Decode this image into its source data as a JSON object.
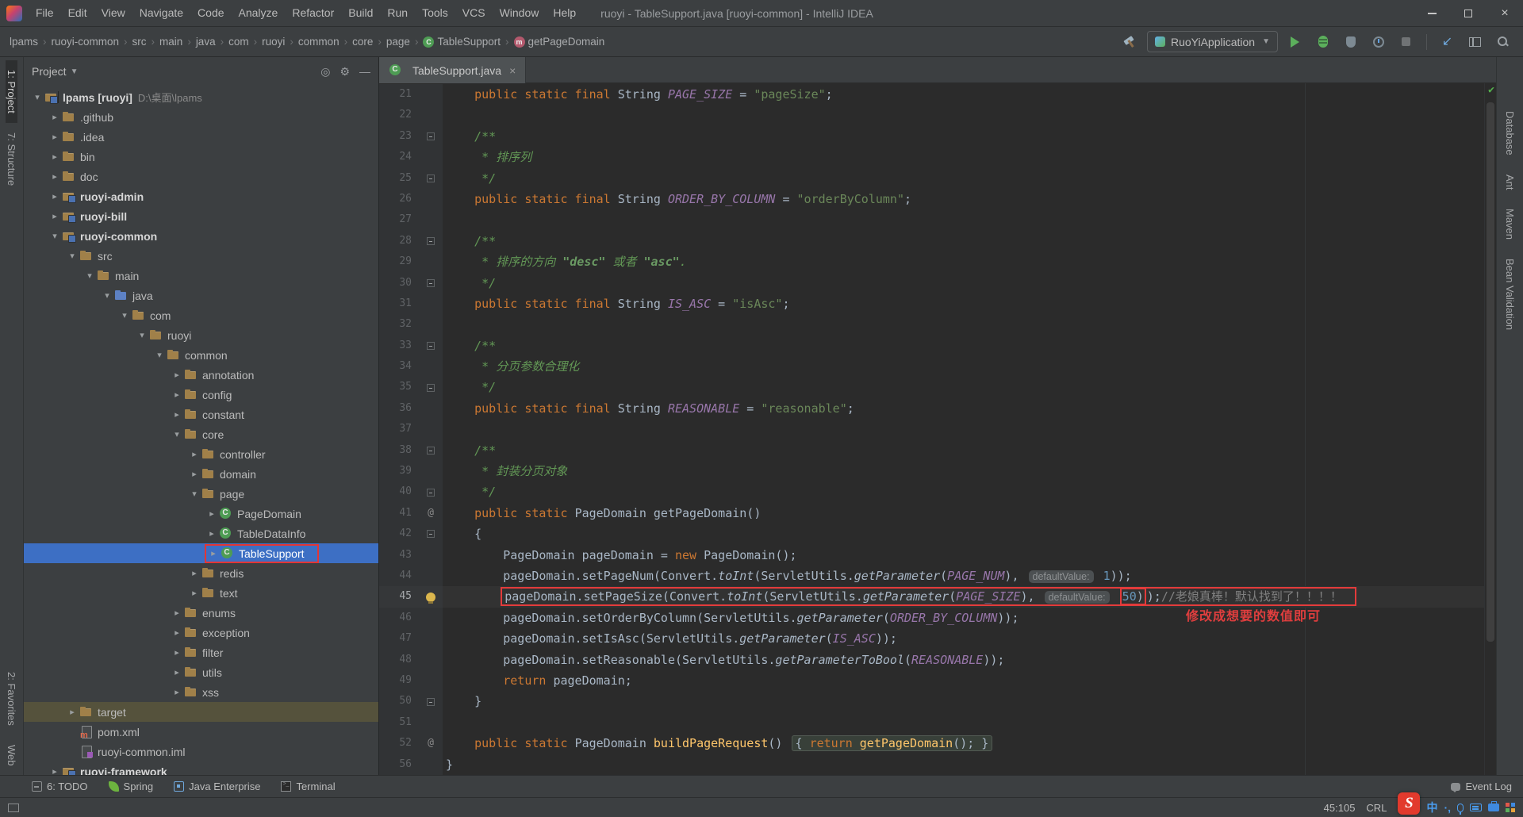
{
  "window": {
    "title": "ruoyi - TableSupport.java [ruoyi-common] - IntelliJ IDEA"
  },
  "menu": {
    "items": [
      "File",
      "Edit",
      "View",
      "Navigate",
      "Code",
      "Analyze",
      "Refactor",
      "Build",
      "Run",
      "Tools",
      "VCS",
      "Window",
      "Help"
    ]
  },
  "breadcrumbs": {
    "items": [
      {
        "label": "lpams"
      },
      {
        "label": "ruoyi-common"
      },
      {
        "label": "src"
      },
      {
        "label": "main"
      },
      {
        "label": "java"
      },
      {
        "label": "com"
      },
      {
        "label": "ruoyi"
      },
      {
        "label": "common"
      },
      {
        "label": "core"
      },
      {
        "label": "page"
      },
      {
        "label": "TableSupport",
        "icon": "class"
      },
      {
        "label": "getPageDomain",
        "icon": "method"
      }
    ]
  },
  "toolbar": {
    "run_config": "RuoYiApplication",
    "icons": [
      "build-hammer-icon",
      "run-icon",
      "debug-icon",
      "coverage-icon",
      "profiler-icon",
      "stop-icon",
      "update-project-icon",
      "layout-icon",
      "search-everywhere-icon"
    ]
  },
  "left_strip": {
    "top": [
      {
        "label": "1: Project",
        "active": true
      },
      {
        "label": "7: Structure"
      }
    ],
    "bottom": [
      {
        "label": "2: Favorites"
      },
      {
        "label": "Web"
      }
    ]
  },
  "right_strip": {
    "top": [
      {
        "label": "Database"
      },
      {
        "label": "Ant"
      },
      {
        "label": "Maven"
      },
      {
        "label": "Bean Validation"
      }
    ]
  },
  "project": {
    "header": "Project",
    "tree": [
      {
        "label": "lpams [ruoyi]",
        "path": "D:\\桌面\\lpams",
        "level": 0,
        "chev": "open",
        "icon": "project",
        "bold": true
      },
      {
        "label": ".github",
        "level": 1,
        "chev": "closed",
        "icon": "folder"
      },
      {
        "label": ".idea",
        "level": 1,
        "chev": "closed",
        "icon": "folder"
      },
      {
        "label": "bin",
        "level": 1,
        "chev": "closed",
        "icon": "folder"
      },
      {
        "label": "doc",
        "level": 1,
        "chev": "closed",
        "icon": "folder"
      },
      {
        "label": "ruoyi-admin",
        "level": 1,
        "chev": "closed",
        "icon": "module",
        "bold": true
      },
      {
        "label": "ruoyi-bill",
        "level": 1,
        "chev": "closed",
        "icon": "module",
        "bold": true
      },
      {
        "label": "ruoyi-common",
        "level": 1,
        "chev": "open",
        "icon": "module",
        "bold": true
      },
      {
        "label": "src",
        "level": 2,
        "chev": "open",
        "icon": "folder"
      },
      {
        "label": "main",
        "level": 3,
        "chev": "open",
        "icon": "folder"
      },
      {
        "label": "java",
        "level": 4,
        "chev": "open",
        "icon": "srcroot"
      },
      {
        "label": "com",
        "level": 5,
        "chev": "open",
        "icon": "package"
      },
      {
        "label": "ruoyi",
        "level": 6,
        "chev": "open",
        "icon": "package"
      },
      {
        "label": "common",
        "level": 7,
        "chev": "open",
        "icon": "package"
      },
      {
        "label": "annotation",
        "level": 8,
        "chev": "closed",
        "icon": "package"
      },
      {
        "label": "config",
        "level": 8,
        "chev": "closed",
        "icon": "package"
      },
      {
        "label": "constant",
        "level": 8,
        "chev": "closed",
        "icon": "package"
      },
      {
        "label": "core",
        "level": 8,
        "chev": "open",
        "icon": "package"
      },
      {
        "label": "controller",
        "level": 9,
        "chev": "closed",
        "icon": "package"
      },
      {
        "label": "domain",
        "level": 9,
        "chev": "closed",
        "icon": "package"
      },
      {
        "label": "page",
        "level": 9,
        "chev": "open",
        "icon": "package"
      },
      {
        "label": "PageDomain",
        "level": 10,
        "chev": "closed",
        "icon": "class"
      },
      {
        "label": "TableDataInfo",
        "level": 10,
        "chev": "closed",
        "icon": "class"
      },
      {
        "label": "TableSupport",
        "level": 10,
        "chev": "closed",
        "icon": "class",
        "selected": true,
        "redbox": true
      },
      {
        "label": "redis",
        "level": 9,
        "chev": "closed",
        "icon": "package"
      },
      {
        "label": "text",
        "level": 9,
        "chev": "closed",
        "icon": "package"
      },
      {
        "label": "enums",
        "level": 8,
        "chev": "closed",
        "icon": "package"
      },
      {
        "label": "exception",
        "level": 8,
        "chev": "closed",
        "icon": "package"
      },
      {
        "label": "filter",
        "level": 8,
        "chev": "closed",
        "icon": "package"
      },
      {
        "label": "utils",
        "level": 8,
        "chev": "closed",
        "icon": "package"
      },
      {
        "label": "xss",
        "level": 8,
        "chev": "closed",
        "icon": "package"
      },
      {
        "label": "target",
        "level": 2,
        "chev": "closed",
        "icon": "folder",
        "hl": true
      },
      {
        "label": "pom.xml",
        "level": 2,
        "chev": "none",
        "icon": "maven"
      },
      {
        "label": "ruoyi-common.iml",
        "level": 2,
        "chev": "none",
        "icon": "iml"
      },
      {
        "label": "ruoyi-framework",
        "level": 1,
        "chev": "closed",
        "icon": "module",
        "bold": true
      }
    ]
  },
  "editor": {
    "tab": "TableSupport.java",
    "lines": [
      {
        "n": 21,
        "segs": [
          {
            "t": "    ",
            "c": "p"
          },
          {
            "t": "public static final ",
            "c": "k"
          },
          {
            "t": "String ",
            "c": "p"
          },
          {
            "t": "PAGE_SIZE",
            "c": "f"
          },
          {
            "t": " = ",
            "c": "p"
          },
          {
            "t": "\"pageSize\"",
            "c": "s"
          },
          {
            "t": ";",
            "c": "p"
          }
        ]
      },
      {
        "n": 22,
        "segs": []
      },
      {
        "n": 23,
        "f": "s",
        "segs": [
          {
            "t": "    ",
            "c": "p"
          },
          {
            "t": "/**",
            "c": "d"
          }
        ]
      },
      {
        "n": 24,
        "segs": [
          {
            "t": "     * 排序列",
            "c": "d"
          }
        ]
      },
      {
        "n": 25,
        "f": "e",
        "segs": [
          {
            "t": "     */",
            "c": "d"
          }
        ]
      },
      {
        "n": 26,
        "segs": [
          {
            "t": "    ",
            "c": "p"
          },
          {
            "t": "public static final ",
            "c": "k"
          },
          {
            "t": "String ",
            "c": "p"
          },
          {
            "t": "ORDER_BY_COLUMN",
            "c": "f"
          },
          {
            "t": " = ",
            "c": "p"
          },
          {
            "t": "\"orderByColumn\"",
            "c": "s"
          },
          {
            "t": ";",
            "c": "p"
          }
        ]
      },
      {
        "n": 27,
        "segs": []
      },
      {
        "n": 28,
        "f": "s",
        "segs": [
          {
            "t": "    ",
            "c": "p"
          },
          {
            "t": "/**",
            "c": "d"
          }
        ]
      },
      {
        "n": 29,
        "segs": [
          {
            "t": "     * 排序的方向 ",
            "c": "d"
          },
          {
            "t": "\"desc\"",
            "c": "b"
          },
          {
            "t": " 或者 ",
            "c": "d"
          },
          {
            "t": "\"asc\"",
            "c": "b"
          },
          {
            "t": ".",
            "c": "d"
          }
        ]
      },
      {
        "n": 30,
        "f": "e",
        "segs": [
          {
            "t": "     */",
            "c": "d"
          }
        ]
      },
      {
        "n": 31,
        "segs": [
          {
            "t": "    ",
            "c": "p"
          },
          {
            "t": "public static final ",
            "c": "k"
          },
          {
            "t": "String ",
            "c": "p"
          },
          {
            "t": "IS_ASC",
            "c": "f"
          },
          {
            "t": " = ",
            "c": "p"
          },
          {
            "t": "\"isAsc\"",
            "c": "s"
          },
          {
            "t": ";",
            "c": "p"
          }
        ]
      },
      {
        "n": 32,
        "segs": []
      },
      {
        "n": 33,
        "f": "s",
        "segs": [
          {
            "t": "    ",
            "c": "p"
          },
          {
            "t": "/**",
            "c": "d"
          }
        ]
      },
      {
        "n": 34,
        "segs": [
          {
            "t": "     * 分页参数合理化",
            "c": "d"
          }
        ]
      },
      {
        "n": 35,
        "f": "e",
        "segs": [
          {
            "t": "     */",
            "c": "d"
          }
        ]
      },
      {
        "n": 36,
        "segs": [
          {
            "t": "    ",
            "c": "p"
          },
          {
            "t": "public static final ",
            "c": "k"
          },
          {
            "t": "String ",
            "c": "p"
          },
          {
            "t": "REASONABLE",
            "c": "f"
          },
          {
            "t": " = ",
            "c": "p"
          },
          {
            "t": "\"reasonable\"",
            "c": "s"
          },
          {
            "t": ";",
            "c": "p"
          }
        ]
      },
      {
        "n": 37,
        "segs": []
      },
      {
        "n": 38,
        "f": "s",
        "segs": [
          {
            "t": "    ",
            "c": "p"
          },
          {
            "t": "/**",
            "c": "d"
          }
        ]
      },
      {
        "n": 39,
        "segs": [
          {
            "t": "     * 封装分页对象",
            "c": "d"
          }
        ]
      },
      {
        "n": 40,
        "f": "e",
        "segs": [
          {
            "t": "     */",
            "c": "d"
          }
        ]
      },
      {
        "n": 41,
        "g": "@",
        "segs": [
          {
            "t": "    ",
            "c": "p"
          },
          {
            "t": "public static ",
            "c": "k"
          },
          {
            "t": "PageDomain getPageDomain()",
            "c": "p"
          }
        ]
      },
      {
        "n": 42,
        "f": "s",
        "segs": [
          {
            "t": "    {",
            "c": "p"
          }
        ]
      },
      {
        "n": 43,
        "segs": [
          {
            "t": "        PageDomain pageDomain = ",
            "c": "p"
          },
          {
            "t": "new",
            "c": "k"
          },
          {
            "t": " PageDomain();",
            "c": "p"
          }
        ]
      },
      {
        "n": 44,
        "segs": [
          {
            "t": "        pageDomain.setPageNum(Convert.",
            "c": "p"
          },
          {
            "t": "toInt",
            "c": "i"
          },
          {
            "t": "(ServletUtils.",
            "c": "p"
          },
          {
            "t": "getParameter",
            "c": "i"
          },
          {
            "t": "(",
            "c": "p"
          },
          {
            "t": "PAGE_NUM",
            "c": "f"
          },
          {
            "t": "), ",
            "c": "p"
          },
          {
            "t": "defaultValue:",
            "c": "h"
          },
          {
            "t": " ",
            "c": "p"
          },
          {
            "t": "1",
            "c": "n"
          },
          {
            "t": "));",
            "c": "p"
          }
        ]
      },
      {
        "n": 45,
        "cur": true,
        "bulb": true,
        "segs": [
          {
            "t": "        ",
            "c": "p"
          },
          {
            "outline": true,
            "parts": [
              {
                "t": "pageDomain.setPageSize(Convert.",
                "c": "p"
              },
              {
                "t": "toInt",
                "c": "i"
              },
              {
                "t": "(ServletUtils.",
                "c": "p"
              },
              {
                "t": "getParameter",
                "c": "i"
              },
              {
                "t": "(",
                "c": "p"
              },
              {
                "t": "PAGE_SIZE",
                "c": "f"
              },
              {
                "t": "), ",
                "c": "p"
              },
              {
                "t": "defaultValue:",
                "c": "h"
              },
              {
                "t": " ",
                "c": "p"
              },
              {
                "box": true,
                "parts": [
                  {
                    "t": "50",
                    "c": "n"
                  },
                  {
                    "t": ")",
                    "c": "p"
                  }
                ]
              },
              {
                "t": ");",
                "c": "p"
              },
              {
                "t": "//老娘真棒！默认找到了！！！！",
                "c": "c"
              }
            ]
          }
        ]
      },
      {
        "n": 46,
        "segs": [
          {
            "t": "        pageDomain.setOrderByColumn(ServletUtils.",
            "c": "p"
          },
          {
            "t": "getParameter",
            "c": "i"
          },
          {
            "t": "(",
            "c": "p"
          },
          {
            "t": "ORDER_BY_COLUMN",
            "c": "f"
          },
          {
            "t": "));",
            "c": "p"
          }
        ]
      },
      {
        "n": 47,
        "segs": [
          {
            "t": "        pageDomain.setIsAsc(ServletUtils.",
            "c": "p"
          },
          {
            "t": "getParameter",
            "c": "i"
          },
          {
            "t": "(",
            "c": "p"
          },
          {
            "t": "IS_ASC",
            "c": "f"
          },
          {
            "t": "));",
            "c": "p"
          }
        ]
      },
      {
        "n": 48,
        "segs": [
          {
            "t": "        pageDomain.setReasonable(ServletUtils.",
            "c": "p"
          },
          {
            "t": "getParameterToBool",
            "c": "i"
          },
          {
            "t": "(",
            "c": "p"
          },
          {
            "t": "REASONABLE",
            "c": "f"
          },
          {
            "t": "));",
            "c": "p"
          }
        ]
      },
      {
        "n": 49,
        "segs": [
          {
            "t": "        ",
            "c": "p"
          },
          {
            "t": "return",
            "c": "k"
          },
          {
            "t": " pageDomain;",
            "c": "p"
          }
        ]
      },
      {
        "n": 50,
        "f": "e",
        "segs": [
          {
            "t": "    }",
            "c": "p"
          }
        ]
      },
      {
        "n": 51,
        "segs": []
      },
      {
        "n": 52,
        "g": "@",
        "segs": [
          {
            "t": "    ",
            "c": "p"
          },
          {
            "t": "public static ",
            "c": "k"
          },
          {
            "t": "PageDomain ",
            "c": "p"
          },
          {
            "t": "buildPageRequest",
            "c": "y"
          },
          {
            "t": "() ",
            "c": "p"
          },
          {
            "chip": true,
            "parts": [
              {
                "t": "{ ",
                "c": "p"
              },
              {
                "t": "return",
                "c": "k"
              },
              {
                "t": " ",
                "c": "p"
              },
              {
                "t": "getPageDomain",
                "c": "y"
              },
              {
                "t": "(); }",
                "c": "p"
              }
            ]
          }
        ]
      },
      {
        "n": 56,
        "segs": [
          {
            "t": "}",
            "c": "p"
          }
        ]
      }
    ]
  },
  "annotations": {
    "tip": "修改成想要的数值即可"
  },
  "bottom_bar": {
    "items": [
      {
        "label": "6: TODO",
        "icon": "todo"
      },
      {
        "label": "Spring",
        "icon": "spring"
      },
      {
        "label": "Java Enterprise",
        "icon": "javaee"
      },
      {
        "label": "Terminal",
        "icon": "terminal"
      }
    ],
    "event_log": "Event Log"
  },
  "status": {
    "caret": "45:105",
    "line_ending": "CRL",
    "ime_lang": "中",
    "ime_icons": [
      "sogou-logo-icon",
      "chinese-mode-icon",
      "punctuation-icon",
      "microphone-icon",
      "keyboard-icon",
      "toolbox-icon",
      "grid-icon"
    ]
  }
}
